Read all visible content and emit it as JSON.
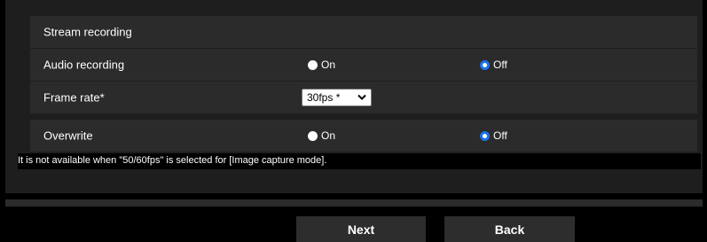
{
  "section": {
    "title": "Stream recording"
  },
  "rows": [
    {
      "label": "Audio recording",
      "options": [
        {
          "label": "On",
          "checked": false
        },
        {
          "label": "Off",
          "checked": true
        }
      ]
    },
    {
      "label": "Frame rate*",
      "select_value": "30fps *"
    },
    {
      "label": "Overwrite",
      "options": [
        {
          "label": "On",
          "checked": false
        },
        {
          "label": "Off",
          "checked": true
        }
      ]
    }
  ],
  "note": "It is not available when \"50/60fps\" is selected for [Image capture mode].",
  "buttons": {
    "next": "Next",
    "back": "Back"
  },
  "colors": {
    "radio_accent": "#1a73e8",
    "row_background": "#2b2b2b",
    "panel_background": "#1e1e1e"
  }
}
